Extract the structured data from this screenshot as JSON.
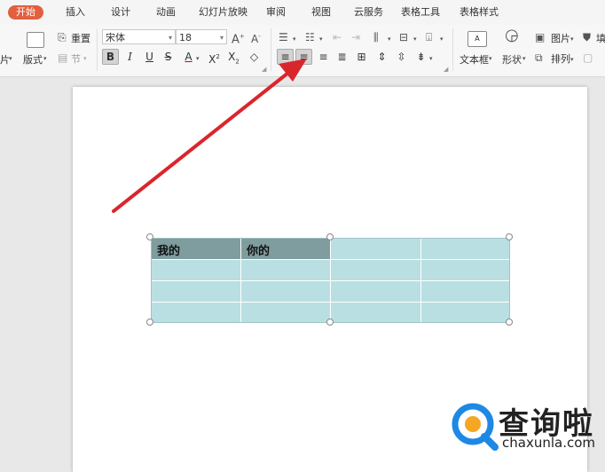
{
  "tabs": [
    {
      "label": "开始",
      "active": true
    },
    {
      "label": "插入"
    },
    {
      "label": "设计"
    },
    {
      "label": "动画"
    },
    {
      "label": "幻灯片放映"
    },
    {
      "label": "审阅"
    },
    {
      "label": "视图"
    },
    {
      "label": "云服务"
    },
    {
      "label": "表格工具"
    },
    {
      "label": "表格样式"
    }
  ],
  "ribbon": {
    "left_cut_label": "片",
    "layout_label": "版式",
    "reset_label": "重置",
    "section_label": "节",
    "font_name": "宋体",
    "font_size": "18",
    "text_box_label": "文本框",
    "shape_label": "形状",
    "picture_label": "图片",
    "arrange_label": "排列",
    "right_cut_label": "填"
  },
  "table": {
    "rows": [
      [
        "我的",
        "你的",
        "",
        ""
      ],
      [
        "",
        "",
        "",
        ""
      ],
      [
        "",
        "",
        "",
        ""
      ],
      [
        "",
        "",
        "",
        ""
      ]
    ]
  },
  "watermark": {
    "title": "查询啦",
    "subtitle": "chaxunla.com"
  },
  "colors": {
    "accent_tab": "#e2603f",
    "table_cell": "#b9dfe2",
    "table_selected": "#7f9c9e",
    "arrow": "#d9262c",
    "logo_blue": "#1e88e5",
    "logo_orange": "#f5a623"
  }
}
